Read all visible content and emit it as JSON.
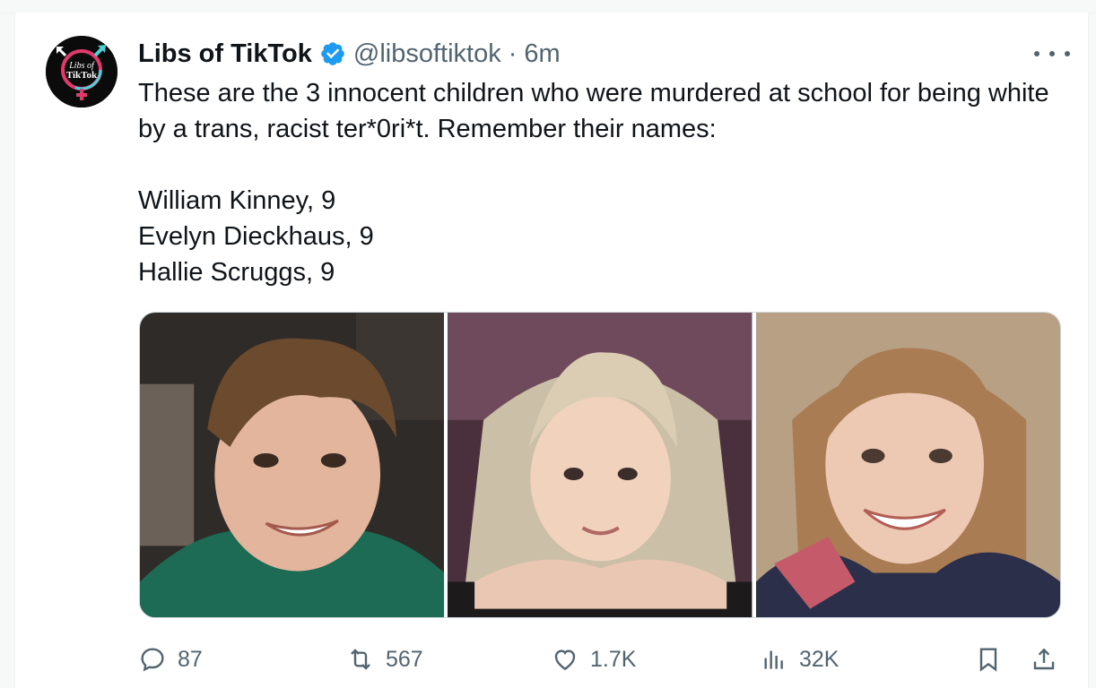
{
  "author": {
    "display_name": "Libs of TikTok",
    "handle": "@libsoftiktok",
    "separator": "·",
    "time": "6m",
    "avatar_text": "Libs of TikTok"
  },
  "tweet": {
    "text": "These are the 3 innocent children who were murdered at school for being white by a trans, racist ter*0ri*t. Remember their names:\n\nWilliam Kinney, 9\nEvelyn Dieckhaus, 9\nHallie Scruggs, 9"
  },
  "metrics": {
    "replies": "87",
    "reposts": "567",
    "likes": "1.7K",
    "views": "32K"
  },
  "colors": {
    "text": "#0f1419",
    "muted": "#536471",
    "verified": "#1d9bf0",
    "border": "#cfd9de"
  }
}
